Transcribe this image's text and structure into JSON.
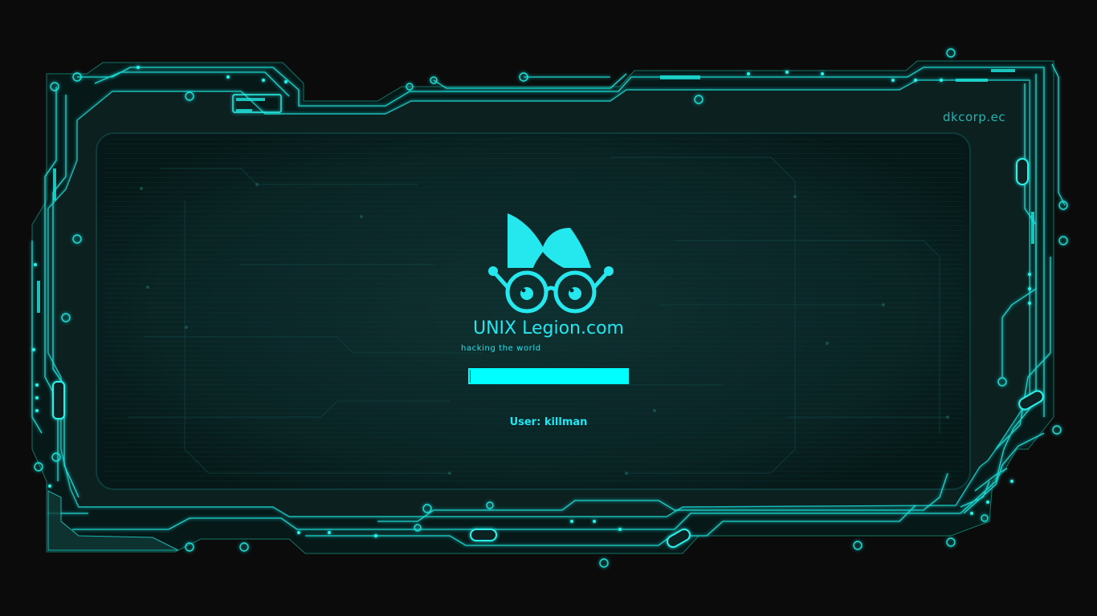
{
  "screen": {
    "background": "#0b0b0b",
    "accent": "#00ffff",
    "frame_color": "#1fd6d0"
  },
  "watermark": "dkcorp.ec",
  "brand": {
    "logo_icon": "nerd-glasses-logo-icon",
    "title": "UNIX Legion.com",
    "tagline": "hacking the world"
  },
  "login": {
    "password_value": "",
    "user_label": "User:",
    "user_name": "killman"
  }
}
